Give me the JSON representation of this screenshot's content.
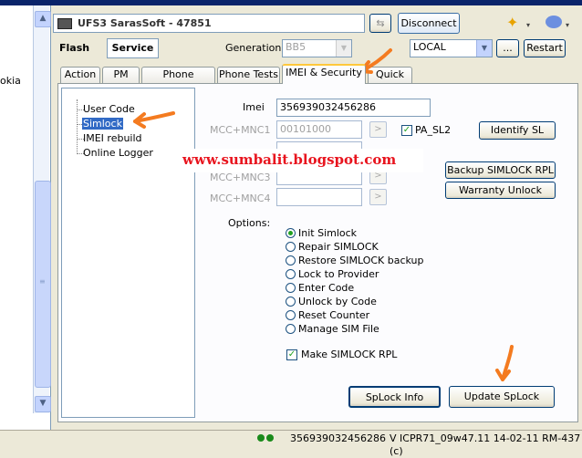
{
  "window": {
    "left_edge_text": "okia"
  },
  "header": {
    "title": "UFS3 SarasSoft - 47851",
    "disconnect_label": "Disconnect",
    "flash_label": "Flash",
    "service_label": "Service",
    "generation_label": "Generation:",
    "generation_value": "BB5",
    "connection_value": "LOCAL",
    "ellipsis_label": "...",
    "restart_label": "Restart"
  },
  "tabs": [
    {
      "label": "Action"
    },
    {
      "label": "PM"
    },
    {
      "label": "Phone Settings"
    },
    {
      "label": "Phone Tests"
    },
    {
      "label": "IMEI & Security"
    },
    {
      "label": "Quick Fix"
    }
  ],
  "tree": {
    "items": [
      {
        "label": "User Code"
      },
      {
        "label": "Simlock"
      },
      {
        "label": "IMEI rebuild"
      },
      {
        "label": "Online Logger"
      }
    ]
  },
  "form": {
    "imei_label": "Imei",
    "imei_value": "356939032456286",
    "mcc1_label": "MCC+MNC1",
    "mcc1_value": "00101000",
    "mcc3_label": "MCC+MNC3",
    "mcc4_label": "MCC+MNC4",
    "arrow_glyph": ">",
    "pa_sl2_label": "PA_SL2",
    "identify_label": "Identify SL",
    "backup_label": "Backup SIMLOCK RPL",
    "warranty_label": "Warranty Unlock",
    "options_label": "Options:",
    "options": [
      {
        "label": "Init Simlock",
        "selected": true
      },
      {
        "label": "Repair SIMLOCK",
        "selected": false
      },
      {
        "label": "Restore SIMLOCK backup",
        "selected": false
      },
      {
        "label": "Lock to Provider",
        "selected": false
      },
      {
        "label": "Enter Code",
        "selected": false
      },
      {
        "label": "Unlock by Code",
        "selected": false
      },
      {
        "label": "Reset Counter",
        "selected": false
      },
      {
        "label": "Manage SIM File",
        "selected": false
      }
    ],
    "make_rpl_label": "Make SIMLOCK RPL",
    "splock_info_label": "SpLock Info",
    "update_splock_label": "Update SpLock"
  },
  "watermark": "www.sumbalit.blogspot.com",
  "status": {
    "imei": "356939032456286",
    "version": "V ICPR71_09w47.11 14-02-11 RM-437 (c)"
  },
  "colors": {
    "accent_orange": "#f47b20",
    "watermark_red": "#e8141e",
    "status_green": "#21a121"
  }
}
